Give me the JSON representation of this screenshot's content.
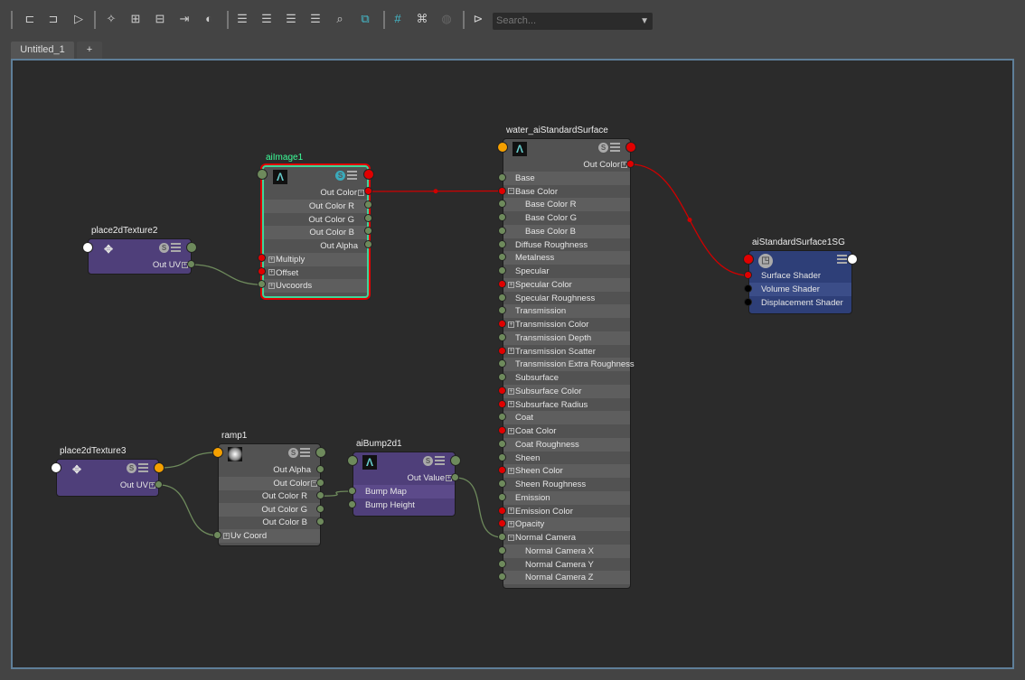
{
  "toolbar": {
    "icons": [
      "input-connections-icon",
      "input-output-connections-icon",
      "output-connections-icon",
      "frame-all-icon",
      "add-to-graph-icon",
      "remove-from-graph-icon",
      "clear-graph-icon",
      "graph-materials-icon",
      "simple-mode-icon",
      "connected-mode-icon",
      "full-mode-icon",
      "custom-mode-icon",
      "search-node-icon",
      "snapshot-icon",
      "toggle-grid-icon",
      "snap-to-grid-icon",
      "swatch-refresh-icon",
      "toggle-sidebar-icon"
    ],
    "search_placeholder": "Search..."
  },
  "tabs": [
    {
      "label": "Untitled_1"
    },
    {
      "label": "+"
    }
  ],
  "colors": {
    "accent": "#5f7f99",
    "wire": "#6e8a5c",
    "wire_red": "#d00000",
    "utility_node": "#4f3f7a",
    "shading_group": "#2e3f78",
    "selected_title": "#3dff9a"
  },
  "nodes": [
    {
      "id": "place2dTexture2",
      "title": "place2dTexture2",
      "type": "utility",
      "icon": "place2d-icon",
      "swatch": "S",
      "rows": [
        {
          "label": "Out UV",
          "side": "out",
          "plug": "green",
          "expand": "plus"
        }
      ]
    },
    {
      "id": "aiImage1",
      "title": "aiImage1",
      "type": "selected",
      "icon": "arnold-icon",
      "swatch": "S",
      "rows": [
        {
          "label": "Out Color",
          "side": "out",
          "plug": "red",
          "expand": "minus"
        },
        {
          "label": "Out Color R",
          "side": "out",
          "plug": "green",
          "child": true
        },
        {
          "label": "Out Color G",
          "side": "out",
          "plug": "green",
          "child": true
        },
        {
          "label": "Out Color B",
          "side": "out",
          "plug": "green",
          "child": true
        },
        {
          "label": "Out Alpha",
          "side": "out",
          "plug": "green"
        },
        {
          "label": "Multiply",
          "side": "in",
          "plug": "red",
          "expand": "plus"
        },
        {
          "label": "Offset",
          "side": "in",
          "plug": "red",
          "expand": "plus"
        },
        {
          "label": "Uvcoords",
          "side": "in",
          "plug": "green",
          "expand": "plus"
        }
      ]
    },
    {
      "id": "place2dTexture3",
      "title": "place2dTexture3",
      "type": "utility",
      "icon": "place2d-icon",
      "swatch": "S",
      "rows": [
        {
          "label": "Out UV",
          "side": "out",
          "plug": "green",
          "expand": "plus"
        }
      ]
    },
    {
      "id": "ramp1",
      "title": "ramp1",
      "type": "texture",
      "icon": "ramp-icon",
      "swatch": "S",
      "rows": [
        {
          "label": "Out Alpha",
          "side": "out",
          "plug": "green"
        },
        {
          "label": "Out Color",
          "side": "out",
          "plug": "green",
          "expand": "minus"
        },
        {
          "label": "Out Color R",
          "side": "out",
          "plug": "green",
          "child": true
        },
        {
          "label": "Out Color G",
          "side": "out",
          "plug": "green",
          "child": true
        },
        {
          "label": "Out Color B",
          "side": "out",
          "plug": "green",
          "child": true
        },
        {
          "label": "Uv Coord",
          "side": "in",
          "plug": "green",
          "expand": "plus"
        }
      ]
    },
    {
      "id": "aiBump2d1",
      "title": "aiBump2d1",
      "type": "utility",
      "icon": "arnold-icon",
      "swatch": "S",
      "rows": [
        {
          "label": "Out Value",
          "side": "out",
          "plug": "green",
          "expand": "plus"
        },
        {
          "label": "Bump Map",
          "side": "in",
          "plug": "green",
          "highlight": true
        },
        {
          "label": "Bump Height",
          "side": "in",
          "plug": "green"
        }
      ]
    },
    {
      "id": "water",
      "title": "water_aiStandardSurface",
      "type": "shader",
      "icon": "arnold-icon",
      "swatch": "S",
      "rows": [
        {
          "label": "Out Color",
          "side": "out",
          "plug": "red",
          "expand": "plus"
        },
        {
          "label": "Base",
          "side": "in",
          "plug": "green"
        },
        {
          "label": "Base Color",
          "side": "in",
          "plug": "red",
          "expand": "minus"
        },
        {
          "label": "Base Color R",
          "side": "in",
          "plug": "green",
          "child": true
        },
        {
          "label": "Base Color G",
          "side": "in",
          "plug": "green",
          "child": true
        },
        {
          "label": "Base Color B",
          "side": "in",
          "plug": "green",
          "child": true
        },
        {
          "label": "Diffuse Roughness",
          "side": "in",
          "plug": "green"
        },
        {
          "label": "Metalness",
          "side": "in",
          "plug": "green"
        },
        {
          "label": "Specular",
          "side": "in",
          "plug": "green"
        },
        {
          "label": "Specular Color",
          "side": "in",
          "plug": "red",
          "expand": "plus"
        },
        {
          "label": "Specular Roughness",
          "side": "in",
          "plug": "green"
        },
        {
          "label": "Transmission",
          "side": "in",
          "plug": "green"
        },
        {
          "label": "Transmission Color",
          "side": "in",
          "plug": "red",
          "expand": "plus"
        },
        {
          "label": "Transmission Depth",
          "side": "in",
          "plug": "green"
        },
        {
          "label": "Transmission Scatter",
          "side": "in",
          "plug": "red",
          "expand": "plus"
        },
        {
          "label": "Transmission Extra Roughness",
          "side": "in",
          "plug": "green"
        },
        {
          "label": "Subsurface",
          "side": "in",
          "plug": "green"
        },
        {
          "label": "Subsurface Color",
          "side": "in",
          "plug": "red",
          "expand": "plus"
        },
        {
          "label": "Subsurface Radius",
          "side": "in",
          "plug": "red",
          "expand": "plus"
        },
        {
          "label": "Coat",
          "side": "in",
          "plug": "green"
        },
        {
          "label": "Coat Color",
          "side": "in",
          "plug": "red",
          "expand": "plus"
        },
        {
          "label": "Coat Roughness",
          "side": "in",
          "plug": "green"
        },
        {
          "label": "Sheen",
          "side": "in",
          "plug": "green"
        },
        {
          "label": "Sheen Color",
          "side": "in",
          "plug": "red",
          "expand": "plus"
        },
        {
          "label": "Sheen Roughness",
          "side": "in",
          "plug": "green"
        },
        {
          "label": "Emission",
          "side": "in",
          "plug": "green"
        },
        {
          "label": "Emission Color",
          "side": "in",
          "plug": "red",
          "expand": "plus"
        },
        {
          "label": "Opacity",
          "side": "in",
          "plug": "red",
          "expand": "plus"
        },
        {
          "label": "Normal Camera",
          "side": "in",
          "plug": "green",
          "expand": "minus"
        },
        {
          "label": "Normal Camera X",
          "side": "in",
          "plug": "green",
          "child": true
        },
        {
          "label": "Normal Camera Y",
          "side": "in",
          "plug": "green",
          "child": true
        },
        {
          "label": "Normal Camera Z",
          "side": "in",
          "plug": "green",
          "child": true
        }
      ]
    },
    {
      "id": "sg",
      "title": "aiStandardSurface1SG",
      "type": "sg",
      "icon": "shading-group-icon",
      "rows": [
        {
          "label": "Surface Shader",
          "side": "in",
          "plug": "red"
        },
        {
          "label": "Volume Shader",
          "side": "in",
          "plug": "black",
          "highlight": true
        },
        {
          "label": "Displacement Shader",
          "side": "in",
          "plug": "black"
        }
      ]
    }
  ],
  "connections": [
    {
      "from": "place2dTexture2.Out UV",
      "to": "aiImage1.Uvcoords"
    },
    {
      "from": "aiImage1.Out Color",
      "to": "water.Base Color"
    },
    {
      "from": "water.Out Color",
      "to": "sg.Surface Shader"
    },
    {
      "from": "place2dTexture3.message",
      "to": "ramp1.message"
    },
    {
      "from": "place2dTexture3.Out UV",
      "to": "ramp1.Uv Coord"
    },
    {
      "from": "ramp1.Out Color R",
      "to": "aiBump2d1.Bump Map"
    },
    {
      "from": "aiBump2d1.Out Value",
      "to": "water.Normal Camera"
    }
  ]
}
